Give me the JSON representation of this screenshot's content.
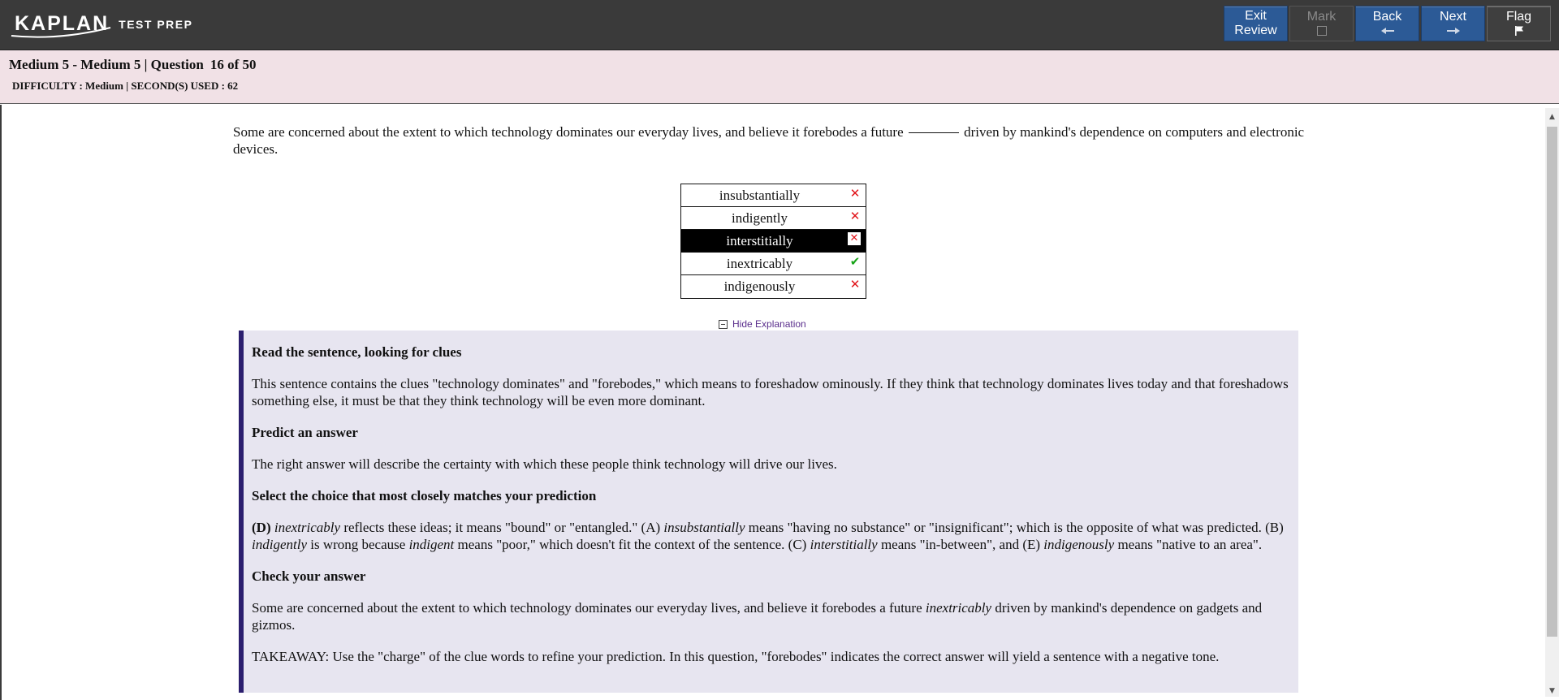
{
  "header": {
    "logo_main": "KAPLAN",
    "logo_sub": "TEST PREP",
    "buttons": {
      "exit_line1": "Exit",
      "exit_line2": "Review",
      "mark": "Mark",
      "back": "Back",
      "next": "Next",
      "flag": "Flag"
    },
    "icons": {
      "mark": "checkbox-icon",
      "back": "arrow-left-icon",
      "next": "arrow-right-icon",
      "flag": "flag-icon"
    }
  },
  "info": {
    "title": "Medium 5 - Medium 5 | Question",
    "question_number": "16 of 50",
    "meta": "DIFFICULTY : Medium | SECOND(S) USED : 62"
  },
  "question": {
    "text_before": "Some are concerned about the extent to which technology dominates our everyday lives, and believe it forebodes a future",
    "text_after": "driven by mankind's dependence on computers and electronic devices."
  },
  "choices": [
    {
      "label": "insubstantially",
      "status": "wrong",
      "selected": false
    },
    {
      "label": "indigently",
      "status": "wrong",
      "selected": false
    },
    {
      "label": "interstitially",
      "status": "wrong",
      "selected": true
    },
    {
      "label": "inextricably",
      "status": "correct",
      "selected": false
    },
    {
      "label": "indigenously",
      "status": "wrong",
      "selected": false
    }
  ],
  "explanation": {
    "toggle_label": "Hide Explanation",
    "h1": "Read the sentence, looking for clues",
    "p1": "This sentence contains the clues \"technology dominates\" and \"forebodes,\" which means to foreshadow ominously. If they think that technology dominates lives today and that foreshadows something else, it must be that they think technology will be even more dominant.",
    "h2": "Predict an answer",
    "p2": "The right answer will describe the certainty with which these people think technology will drive our lives.",
    "h3": "Select the choice that most closely matches your prediction",
    "p3": {
      "s1": "(D)",
      "s2": "inextricably",
      "s3": "reflects these ideas; it means \"bound\" or \"entangled.\" (A)",
      "s4": "insubstantially",
      "s5": "means \"having no substance\" or \"insignificant\"; which is the opposite of what was predicted. (B)",
      "s6": "indigently",
      "s7": "is wrong because",
      "s8": "indigent",
      "s9": "means \"poor,\" which doesn't fit the context of the sentence. (C)",
      "s10": "interstitially",
      "s11": "means \"in-between\", and (E)",
      "s12": "indigenously",
      "s13": "means \"native to an area\"."
    },
    "h4": "Check your answer",
    "p4": {
      "s1": "Some are concerned about the extent to which technology dominates our everyday lives, and believe it forebodes a future",
      "s2": "inextricably",
      "s3": "driven by mankind's dependence on gadgets and gizmos."
    },
    "p5": "TAKEAWAY: Use the \"charge\" of the clue words to refine your prediction. In this question, \"forebodes\" indicates the correct answer will yield a sentence with a negative tone."
  },
  "colors": {
    "topbar": "#3a3a3a",
    "button_blue": "#2c5a96",
    "infobar": "#f1e1e6",
    "explanation_bg": "#e7e5f0",
    "explanation_accent": "#2b1e6e",
    "wrong": "#e1141a",
    "correct": "#18a418"
  }
}
